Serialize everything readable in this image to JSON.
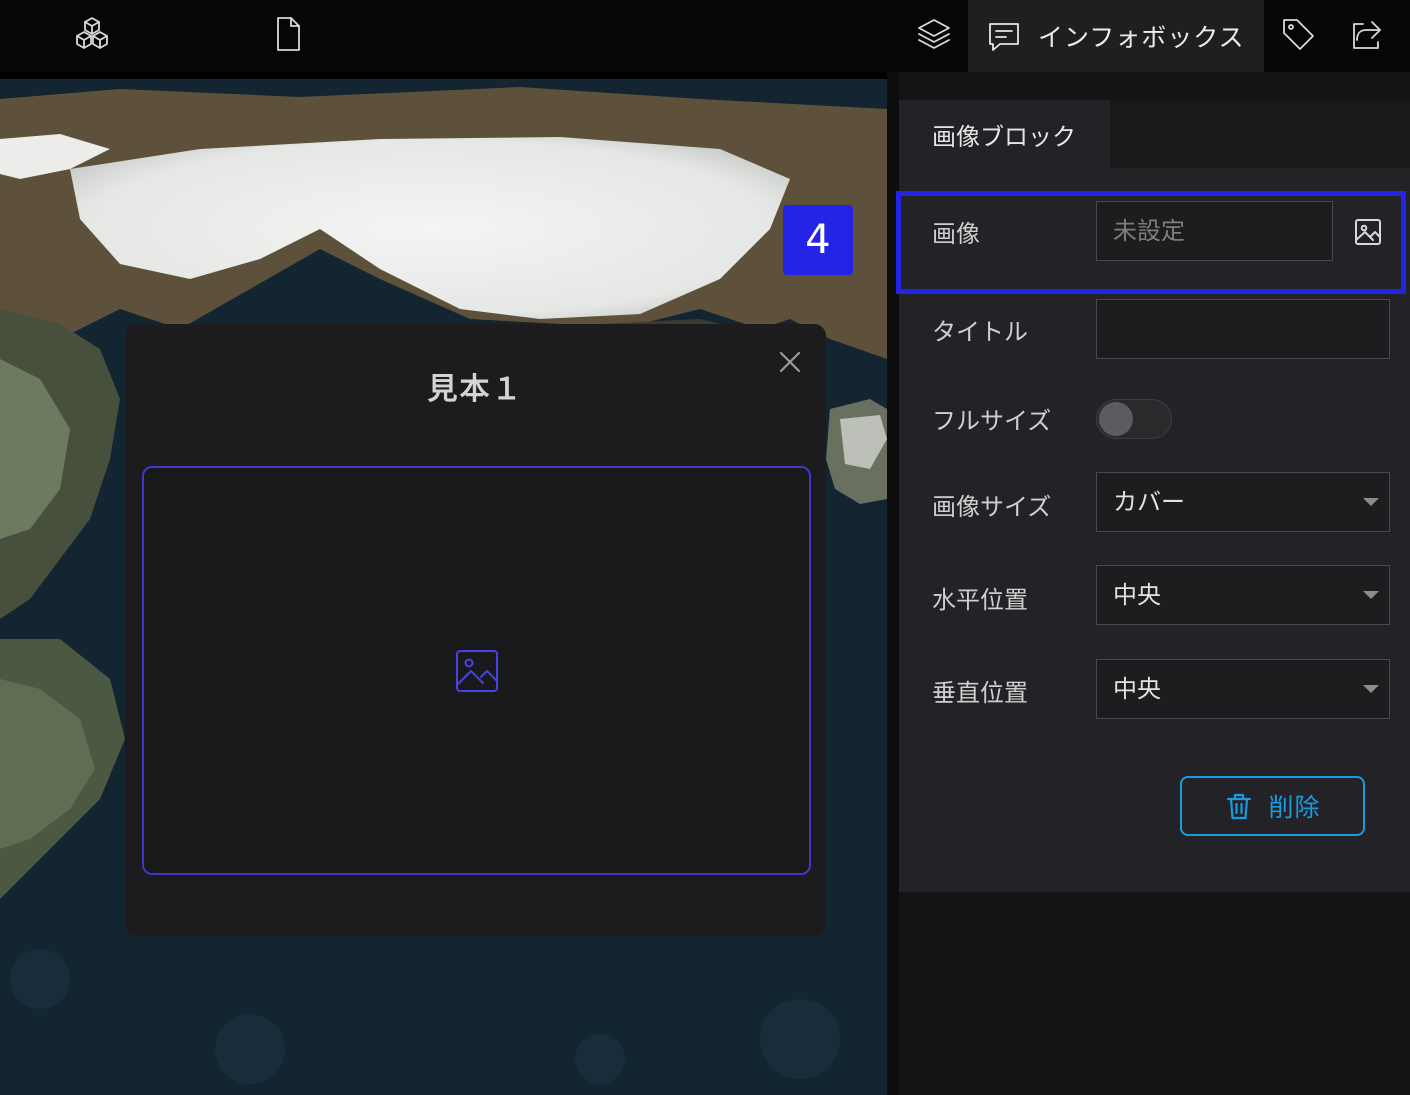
{
  "topbar": {
    "left_icons": [
      "cubes-icon",
      "file-icon"
    ],
    "right_icons": [
      "layers-icon",
      "tag-icon",
      "export-icon"
    ],
    "active_tab": {
      "icon": "message-square-icon",
      "label": "インフォボックス"
    }
  },
  "modal": {
    "title": "見本１",
    "image_placeholder_icon": "image-icon"
  },
  "annotation": {
    "badge": "4"
  },
  "panel": {
    "tab_label": "画像ブロック",
    "image": {
      "label": "画像",
      "placeholder": "未設定"
    },
    "title": {
      "label": "タイトル",
      "value": ""
    },
    "fullsize": {
      "label": "フルサイズ",
      "on": false
    },
    "image_size": {
      "label": "画像サイズ",
      "value": "カバー"
    },
    "horizontal": {
      "label": "水平位置",
      "value": "中央"
    },
    "vertical": {
      "label": "垂直位置",
      "value": "中央"
    },
    "delete_label": "削除"
  },
  "colors": {
    "accent_blue": "#1a9be0",
    "highlight": "#2424e6",
    "image_border": "#4038c8"
  }
}
